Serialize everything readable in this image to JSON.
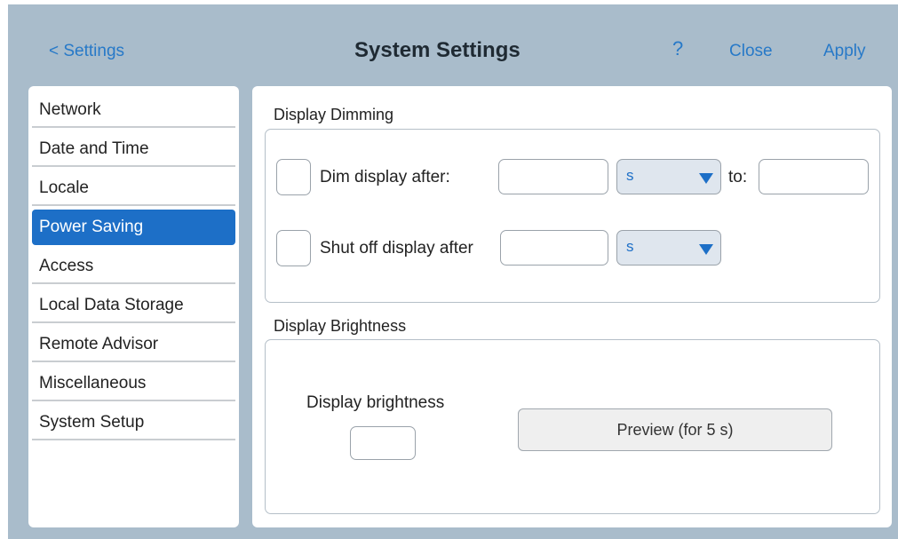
{
  "header": {
    "back_label": "< Settings",
    "title": "System Settings",
    "help_label": "?",
    "close_label": "Close",
    "apply_label": "Apply"
  },
  "sidebar": {
    "items": [
      {
        "label": "Network"
      },
      {
        "label": "Date and Time"
      },
      {
        "label": "Locale"
      },
      {
        "label": "Power Saving",
        "active": true
      },
      {
        "label": "Access"
      },
      {
        "label": "Local Data Storage"
      },
      {
        "label": "Remote Advisor"
      },
      {
        "label": "Miscellaneous"
      },
      {
        "label": "System Setup"
      }
    ]
  },
  "dimming": {
    "section_title": "Display Dimming",
    "dim_label": "Dim display after:",
    "dim_value": "",
    "dim_unit": "s",
    "to_label": "to:",
    "to_value": "",
    "shutoff_label": "Shut off display after",
    "shutoff_value": "",
    "shutoff_unit": "s"
  },
  "brightness": {
    "section_title": "Display Brightness",
    "label": "Display brightness",
    "value": "",
    "preview_label": "Preview (for 5 s)"
  },
  "colors": {
    "accent": "#1d6fc7",
    "link": "#2779c8",
    "frame": "#a9bccb"
  }
}
